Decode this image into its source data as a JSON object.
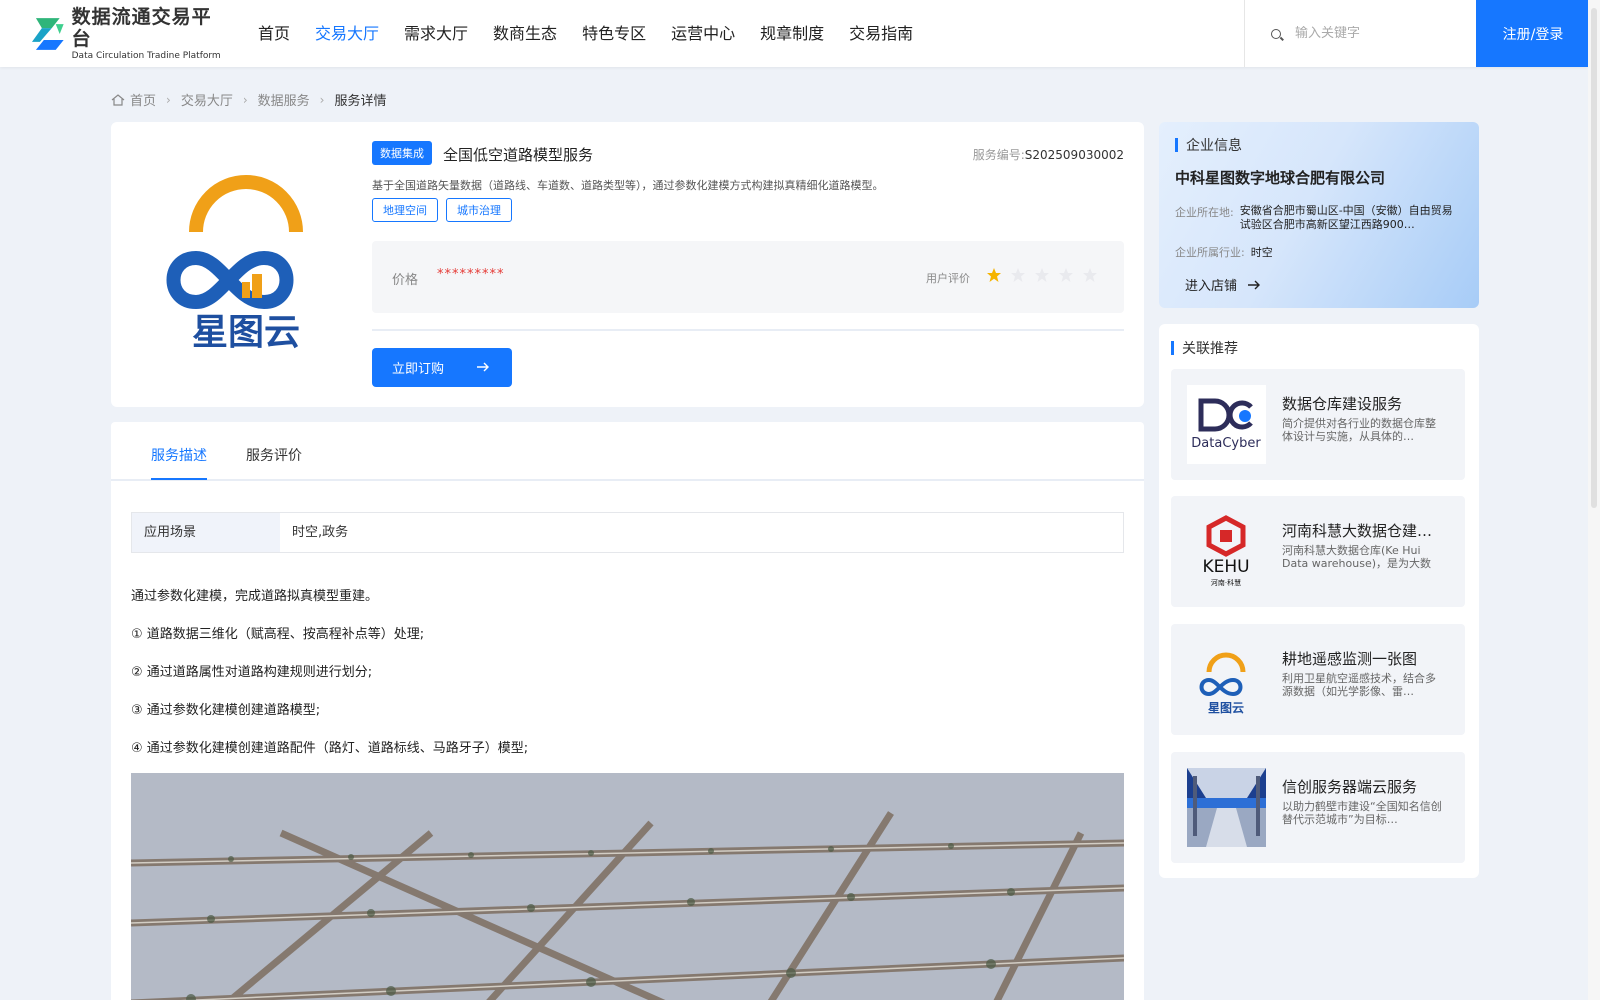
{
  "header": {
    "logo_title": "数据流通交易平台",
    "logo_subtitle": "Data Circulation Tradine Platform",
    "nav": [
      "首页",
      "交易大厅",
      "需求大厅",
      "数商生态",
      "特色专区",
      "运营中心",
      "规章制度",
      "交易指南"
    ],
    "active_nav": "交易大厅",
    "search_placeholder": "输入关键字",
    "login_label": "注册/登录",
    "accent_color": "#1677ff"
  },
  "breadcrumb": [
    "首页",
    "交易大厅",
    "数据服务",
    "服务详情"
  ],
  "product": {
    "logo_text": "星图云",
    "category_tag": "数据集成",
    "title": "全国低空道路模型服务",
    "service_no_label": "服务编号:",
    "service_no": "S202509030002",
    "description": "基于全国道路矢量数据（道路线、车道数、道路类型等），通过参数化建模方式构建拟真精细化道路模型。",
    "tags": [
      "地理空间",
      "城市治理"
    ],
    "price_label": "价格",
    "price_value": "*********",
    "rating_label": "用户评价",
    "rating": 1,
    "rating_max": 5,
    "order_label": "立即订购"
  },
  "tabs": [
    "服务描述",
    "服务评价"
  ],
  "active_tab": "服务描述",
  "scene": {
    "key": "应用场景",
    "value": "时空,政务"
  },
  "desc_lines": [
    "通过参数化建模，完成道路拟真模型重建。",
    "① 道路数据三维化（赋高程、按高程补点等）处理;",
    "② 通过道路属性对道路构建规则进行划分;",
    "③ 通过参数化建模创建道路模型;",
    "④ 通过参数化建模创建道路配件（路灯、道路标线、马路牙子）模型;"
  ],
  "company": {
    "section_title": "企业信息",
    "name": "中科星图数字地球合肥有限公司",
    "addr_label": "企业所在地:",
    "addr": "安徽省合肥市蜀山区-中国（安徽）自由贸易试验区合肥市高新区望江西路900…",
    "industry_label": "企业所属行业:",
    "industry": "时空",
    "enter_label": "进入店铺"
  },
  "recommend": {
    "section_title": "关联推荐",
    "items": [
      {
        "title": "数据仓库建设服务",
        "desc": "简介提供对各行业的数据仓库整体设计与实施，从具体的…",
        "thumb": "datacyber-logo",
        "thumb_text": "DataCyber"
      },
      {
        "title": "河南科慧大数据仓建…",
        "desc": "河南科慧大数据仓库(Ke Hui Data warehouse)，是为大数据…",
        "thumb": "kehui-logo",
        "thumb_text": "KEHU",
        "thumb_sub": "河南·科慧"
      },
      {
        "title": "耕地遥感监测一张图",
        "desc": "利用卫星航空遥感技术，结合多源数据（如光学影像、雷…",
        "thumb": "xingtuyun-logo",
        "thumb_text": "星图云"
      },
      {
        "title": "信创服务器端云服务",
        "desc": "以助力鹤壁市建设“全国知名信创替代示范城市”为目标…",
        "thumb": "server-room-photo"
      }
    ]
  }
}
